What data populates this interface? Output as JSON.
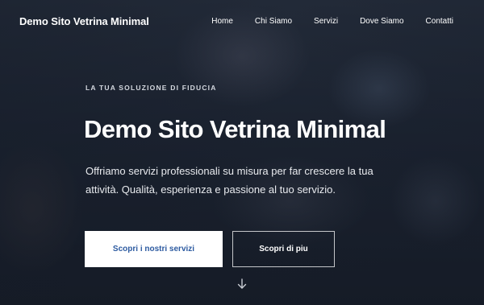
{
  "brand": {
    "name": "Demo Sito Vetrina Minimal"
  },
  "nav": {
    "items": [
      {
        "label": "Home"
      },
      {
        "label": "Chi Siamo"
      },
      {
        "label": "Servizi"
      },
      {
        "label": "Dove Siamo"
      },
      {
        "label": "Contatti"
      }
    ]
  },
  "hero": {
    "eyebrow": "LA TUA SOLUZIONE DI FIDUCIA",
    "title": "Demo Sito Vetrina Minimal",
    "subtitle": "Offriamo servizi professionali su misura per far crescere la tua attività. Qualità, esperienza e passione al tuo servizio.",
    "primary_button": "Scopri i nostri servizi",
    "secondary_button": "Scopri di piu",
    "scroll_icon": "arrow-down-icon"
  },
  "colors": {
    "primary_button_text": "#2c5aa0",
    "overlay": "#1b2433"
  }
}
